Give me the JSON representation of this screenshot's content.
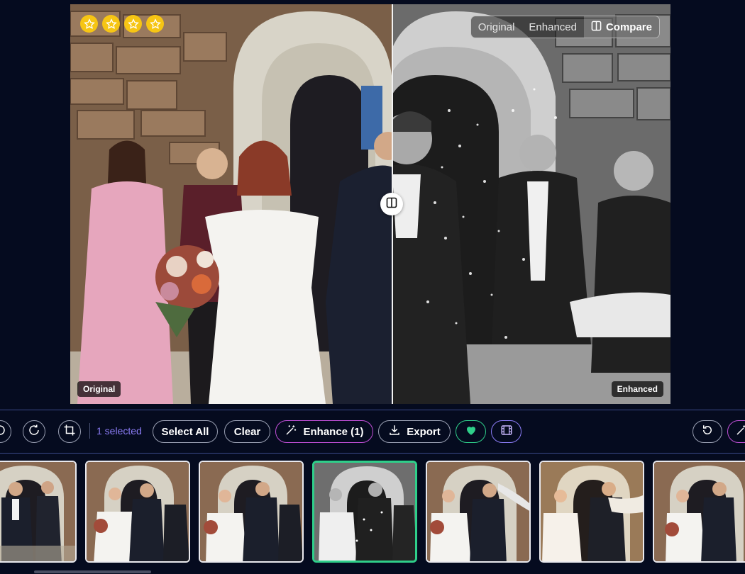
{
  "viewer": {
    "rating": 4,
    "stars": [
      "star-1",
      "star-2",
      "star-3",
      "star-4"
    ],
    "compare_modes": [
      "Original",
      "Enhanced",
      "Compare"
    ],
    "active_mode": "Compare",
    "left_label": "Original",
    "right_label": "Enhanced",
    "split_position": 0.537
  },
  "toolbar": {
    "selected_text": "1 selected",
    "select_all": "Select All",
    "clear": "Clear",
    "enhance": "Enhance (1)",
    "export": "Export"
  },
  "filmstrip": {
    "count": 7,
    "selected_index": 3,
    "tones": [
      "color",
      "color",
      "color",
      "bw",
      "color",
      "warm",
      "color"
    ]
  },
  "colors": {
    "background": "#050b1f",
    "accent_purple": "#8b7cf6",
    "accent_green": "#2fcf8a",
    "enhance_border": "#c04fd6",
    "star": "#f6c514"
  }
}
